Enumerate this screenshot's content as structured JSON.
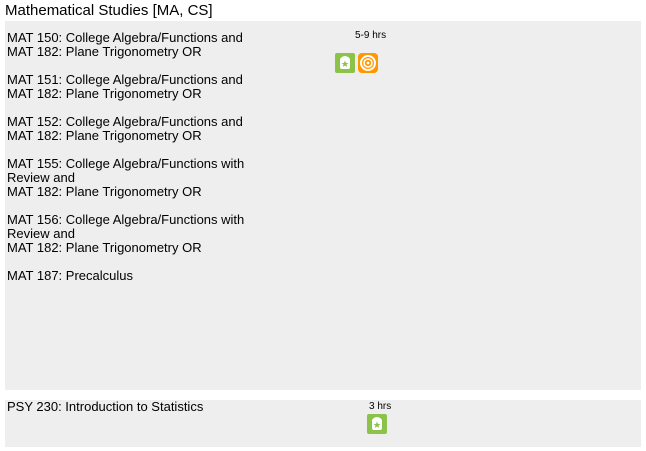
{
  "page": {
    "title": "Mathematical Studies [MA, CS]"
  },
  "sections": [
    {
      "hours": "5-9 hrs",
      "icons": [
        "green-badge-icon",
        "orange-circles-icon"
      ],
      "courses": [
        {
          "lines": [
            "MAT 150: College Algebra/Functions and",
            "MAT 182: Plane Trigonometry OR"
          ]
        },
        {
          "lines": [
            "MAT 151: College Algebra/Functions and",
            "MAT 182: Plane Trigonometry OR"
          ]
        },
        {
          "lines": [
            "MAT 152: College Algebra/Functions and",
            "MAT 182: Plane Trigonometry OR"
          ]
        },
        {
          "lines": [
            "MAT 155: College Algebra/Functions with",
            "Review and",
            "MAT 182: Plane Trigonometry OR"
          ]
        },
        {
          "lines": [
            "MAT 156: College Algebra/Functions with",
            "Review and",
            "MAT 182: Plane Trigonometry OR"
          ]
        },
        {
          "lines": [
            "MAT 187: Precalculus"
          ]
        }
      ]
    },
    {
      "hours": "3 hrs",
      "icons": [
        "green-badge-icon"
      ],
      "courses": [
        {
          "lines": [
            "PSY 230: Introduction to Statistics"
          ]
        }
      ]
    }
  ],
  "colors": {
    "row_background": "#eeeeee",
    "green_icon": "#8bc34a",
    "orange_icon": "#ff9800"
  }
}
